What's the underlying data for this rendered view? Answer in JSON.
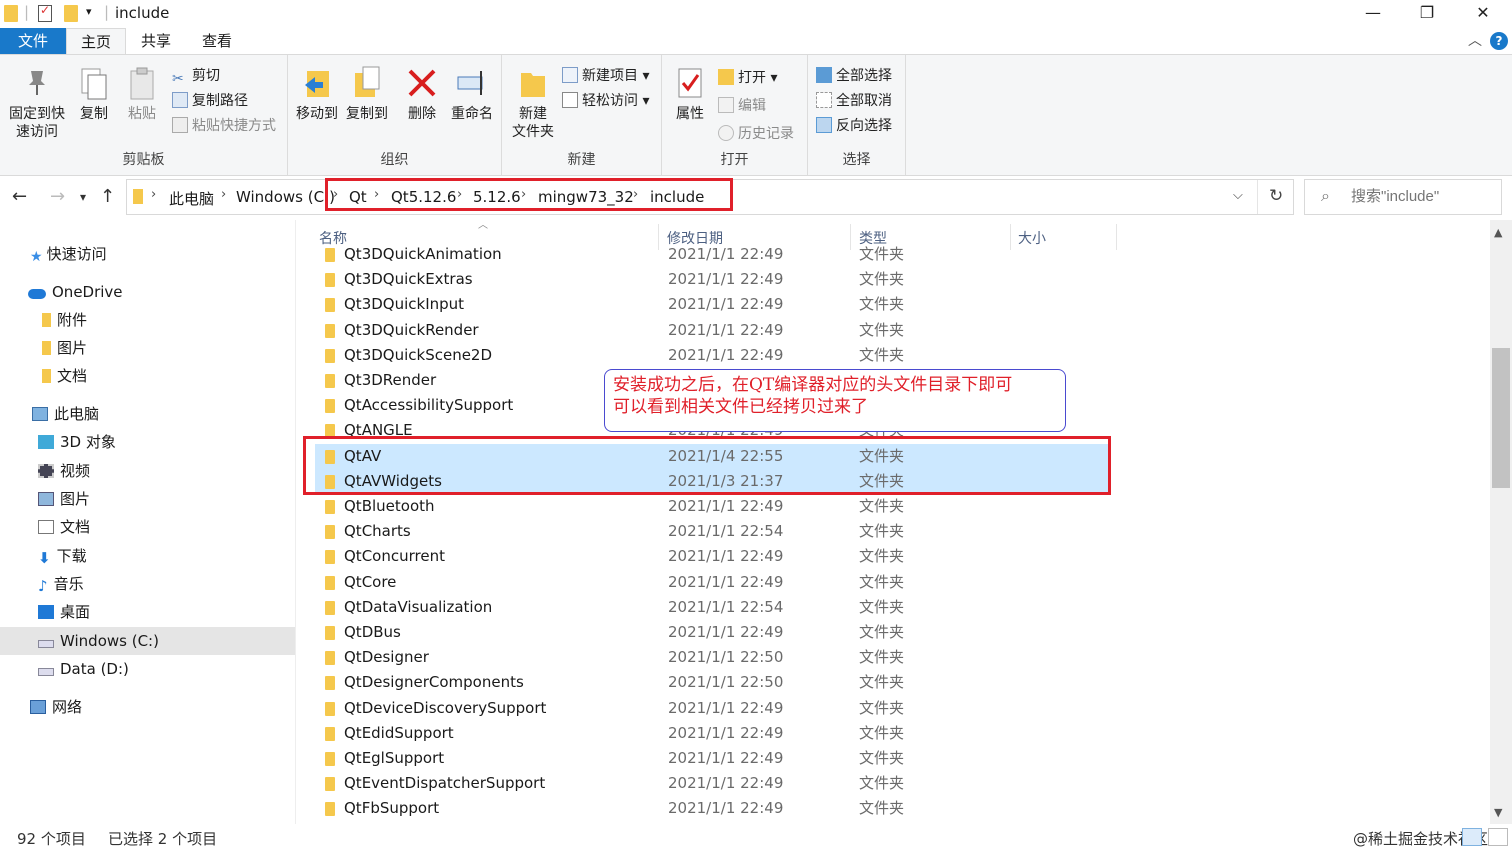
{
  "window": {
    "title": "include",
    "controls": {
      "minimize": "—",
      "maximize": "❐",
      "close": "✕"
    }
  },
  "ribbon": {
    "tabs": [
      "文件",
      "主页",
      "共享",
      "查看"
    ],
    "active_tab": "主页",
    "clipboard": {
      "pin_label_1": "固定到快",
      "pin_label_2": "速访问",
      "copy": "复制",
      "paste": "粘贴",
      "cut": "剪切",
      "copy_path": "复制路径",
      "paste_shortcut": "粘贴快捷方式",
      "group": "剪贴板"
    },
    "organize": {
      "move_to": "移动到",
      "copy_to": "复制到",
      "delete": "删除",
      "rename": "重命名",
      "group": "组织"
    },
    "new": {
      "new_folder_1": "新建",
      "new_folder_2": "文件夹",
      "new_item": "新建项目",
      "easy_access": "轻松访问",
      "group": "新建"
    },
    "open": {
      "properties": "属性",
      "open": "打开",
      "edit": "编辑",
      "history": "历史记录",
      "group": "打开"
    },
    "select": {
      "select_all": "全部选择",
      "select_none": "全部取消",
      "invert": "反向选择",
      "group": "选择"
    }
  },
  "address": {
    "crumbs": [
      "此电脑",
      "Windows (C:)",
      "Qt",
      "Qt5.12.6",
      "5.12.6",
      "mingw73_32",
      "include"
    ],
    "search_placeholder": "搜索\"include\""
  },
  "sidebar": {
    "items": [
      {
        "label": "快速访问",
        "icon": "star-icon"
      },
      {
        "label": "OneDrive",
        "icon": "cloud-icon"
      },
      {
        "label": "附件",
        "icon": "folder-icon"
      },
      {
        "label": "图片",
        "icon": "folder-icon"
      },
      {
        "label": "文档",
        "icon": "folder-icon"
      },
      {
        "label": "此电脑",
        "icon": "computer-icon"
      },
      {
        "label": "3D 对象",
        "icon": "cube-icon"
      },
      {
        "label": "视频",
        "icon": "film-icon"
      },
      {
        "label": "图片",
        "icon": "pictures-icon"
      },
      {
        "label": "文档",
        "icon": "document-icon"
      },
      {
        "label": "下载",
        "icon": "download-icon"
      },
      {
        "label": "音乐",
        "icon": "music-icon"
      },
      {
        "label": "桌面",
        "icon": "desktop-icon"
      },
      {
        "label": "Windows (C:)",
        "icon": "drive-icon"
      },
      {
        "label": "Data (D:)",
        "icon": "drive-icon"
      },
      {
        "label": "网络",
        "icon": "network-icon"
      }
    ]
  },
  "columns": {
    "name": "名称",
    "date": "修改日期",
    "type": "类型",
    "size": "大小"
  },
  "files": [
    {
      "name": "Qt3DQuickAnimation",
      "date": "2021/1/1 22:49",
      "type": "文件夹"
    },
    {
      "name": "Qt3DQuickExtras",
      "date": "2021/1/1 22:49",
      "type": "文件夹"
    },
    {
      "name": "Qt3DQuickInput",
      "date": "2021/1/1 22:49",
      "type": "文件夹"
    },
    {
      "name": "Qt3DQuickRender",
      "date": "2021/1/1 22:49",
      "type": "文件夹"
    },
    {
      "name": "Qt3DQuickScene2D",
      "date": "2021/1/1 22:49",
      "type": "文件夹"
    },
    {
      "name": "Qt3DRender",
      "date": "2021/1/1 22:49",
      "type": "文件夹"
    },
    {
      "name": "QtAccessibilitySupport",
      "date": "2021/1/1 22:49",
      "type": "文件夹"
    },
    {
      "name": "QtANGLE",
      "date": "2021/1/1 22:49",
      "type": "文件夹"
    },
    {
      "name": "QtAV",
      "date": "2021/1/4 22:55",
      "type": "文件夹",
      "selected": true
    },
    {
      "name": "QtAVWidgets",
      "date": "2021/1/3 21:37",
      "type": "文件夹",
      "selected": true
    },
    {
      "name": "QtBluetooth",
      "date": "2021/1/1 22:49",
      "type": "文件夹"
    },
    {
      "name": "QtCharts",
      "date": "2021/1/1 22:54",
      "type": "文件夹"
    },
    {
      "name": "QtConcurrent",
      "date": "2021/1/1 22:49",
      "type": "文件夹"
    },
    {
      "name": "QtCore",
      "date": "2021/1/1 22:49",
      "type": "文件夹"
    },
    {
      "name": "QtDataVisualization",
      "date": "2021/1/1 22:54",
      "type": "文件夹"
    },
    {
      "name": "QtDBus",
      "date": "2021/1/1 22:49",
      "type": "文件夹"
    },
    {
      "name": "QtDesigner",
      "date": "2021/1/1 22:50",
      "type": "文件夹"
    },
    {
      "name": "QtDesignerComponents",
      "date": "2021/1/1 22:50",
      "type": "文件夹"
    },
    {
      "name": "QtDeviceDiscoverySupport",
      "date": "2021/1/1 22:49",
      "type": "文件夹"
    },
    {
      "name": "QtEdidSupport",
      "date": "2021/1/1 22:49",
      "type": "文件夹"
    },
    {
      "name": "QtEglSupport",
      "date": "2021/1/1 22:49",
      "type": "文件夹"
    },
    {
      "name": "QtEventDispatcherSupport",
      "date": "2021/1/1 22:49",
      "type": "文件夹"
    },
    {
      "name": "QtFbSupport",
      "date": "2021/1/1 22:49",
      "type": "文件夹"
    }
  ],
  "annotation": {
    "line1": "安装成功之后，在QT编译器对应的头文件目录下即可",
    "line2": "可以看到相关文件已经拷贝过来了"
  },
  "status": {
    "count": "92 个项目",
    "selected": "已选择 2 个项目",
    "watermark": "@稀土掘金技术社区"
  },
  "colors": {
    "accent": "#1979ca",
    "selection": "#cce8ff",
    "highlight": "#e0202a"
  }
}
